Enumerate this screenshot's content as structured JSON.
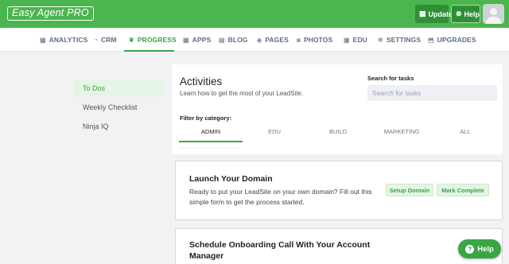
{
  "header": {
    "logo_text": "Easy Agent PRO",
    "updates_label": "Updates",
    "help_label": "Help",
    "avatar_icon": "user-avatar"
  },
  "nav": {
    "items": [
      {
        "label": "ANALYTICS",
        "icon": "grid-icon"
      },
      {
        "label": "CRM",
        "icon": "person-icon"
      },
      {
        "label": "PROGRESS",
        "icon": "leaf-icon",
        "active": true
      },
      {
        "label": "APPS",
        "icon": "apps-icon"
      },
      {
        "label": "BLOG",
        "icon": "blog-icon"
      },
      {
        "label": "PAGES",
        "icon": "layers-icon"
      },
      {
        "label": "PHOTOS",
        "icon": "camera-icon"
      },
      {
        "label": "EDU",
        "icon": "book-icon"
      },
      {
        "label": "SETTINGS",
        "icon": "gear-icon"
      },
      {
        "label": "UPGRADES",
        "icon": "upgrade-icon"
      }
    ]
  },
  "sidebar": {
    "items": [
      {
        "label": "To Dos",
        "active": true
      },
      {
        "label": "Weekly Checklist"
      },
      {
        "label": "Ninja IQ"
      }
    ]
  },
  "main": {
    "title": "Activities",
    "subtitle": "Learn how to get the most of your LeadSite.",
    "search_label": "Search for tasks",
    "search_placeholder": "Search for tasks",
    "filter_label": "Filter by category:",
    "filters": [
      "ADMIN",
      "EDU",
      "BUILD",
      "MARKETING",
      "ALL"
    ]
  },
  "tasks": [
    {
      "title": "Launch Your Domain",
      "description": "Ready to put your LeadSite on your own domain? Fill out this simple form to get the process started.",
      "primary_button": "Setup Domain",
      "secondary_button": "Mark Complete"
    },
    {
      "title": "Schedule Onboarding Call With Your Account Manager"
    }
  ],
  "help_fab_label": "Help",
  "colors": {
    "brand_green": "#4bb54f",
    "accent_green": "#3aa545"
  }
}
